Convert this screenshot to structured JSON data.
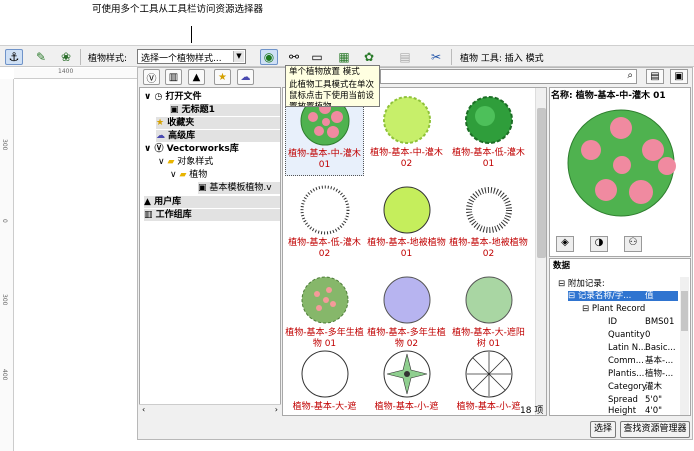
{
  "top_note": "可使用多个工具从工具栏访问资源选择器",
  "toolbar": {
    "plant_style_label": "植物样式:",
    "plant_style_value": "选择一个植物样式...",
    "mode_label": "植物 工具: 插入 模式"
  },
  "ruler": {
    "h_label": "1400",
    "v_labels": [
      "300",
      "0",
      "300",
      "400"
    ]
  },
  "tooltip": {
    "title": "单个植物放置 模式",
    "text": "此植物工具模式在单次鼠标点击下使用当前设置放置植物。"
  },
  "tree": {
    "open_file": "打开文件",
    "untitled": "无标题1",
    "favorites": "收藏夹",
    "advanced": "高级库",
    "vw_lib": "Vectorworks库",
    "obj_styles": "对象样式",
    "plants": "植物",
    "template": "基本模板植物.v",
    "user_lib": "用户库",
    "workgroup": "工作组库"
  },
  "items": [
    {
      "label": "植物-基本-中-灌木 01"
    },
    {
      "label": "植物-基本-中-灌木 02"
    },
    {
      "label": "植物-基本-低-灌木 01"
    },
    {
      "label": "植物-基本-低-灌木 02"
    },
    {
      "label": "植物-基本-地被植物 01"
    },
    {
      "label": "植物-基本-地被植物 02"
    },
    {
      "label": "植物-基本-多年生植物 01"
    },
    {
      "label": "植物-基本-多年生植物 02"
    },
    {
      "label": "植物-基本-大-遮阳树 01"
    },
    {
      "label": "植物-基本-大-遮"
    },
    {
      "label": "植物-基本-小-遮"
    },
    {
      "label": "植物-基本-小-遮"
    }
  ],
  "item_count": "18 项",
  "preview": {
    "name_label": "名称:",
    "name": "植物-基本-中-灌木 01"
  },
  "data_panel": {
    "title": "数据",
    "attached": "附加记录:",
    "col_name": "记录名称/字...",
    "col_value": "值",
    "record": "Plant Record",
    "fields": [
      {
        "k": "ID",
        "v": "BMS01"
      },
      {
        "k": "Quantity",
        "v": "0"
      },
      {
        "k": "Latin N...",
        "v": "Basic..."
      },
      {
        "k": "Comm...",
        "v": "基本-..."
      },
      {
        "k": "Plantis...",
        "v": "植物-..."
      },
      {
        "k": "Category",
        "v": "灌木"
      },
      {
        "k": "Spread",
        "v": "5'0\""
      },
      {
        "k": "Height",
        "v": "4'0\""
      }
    ]
  },
  "buttons": {
    "select": "选择",
    "manager": "查找资源管理器"
  }
}
